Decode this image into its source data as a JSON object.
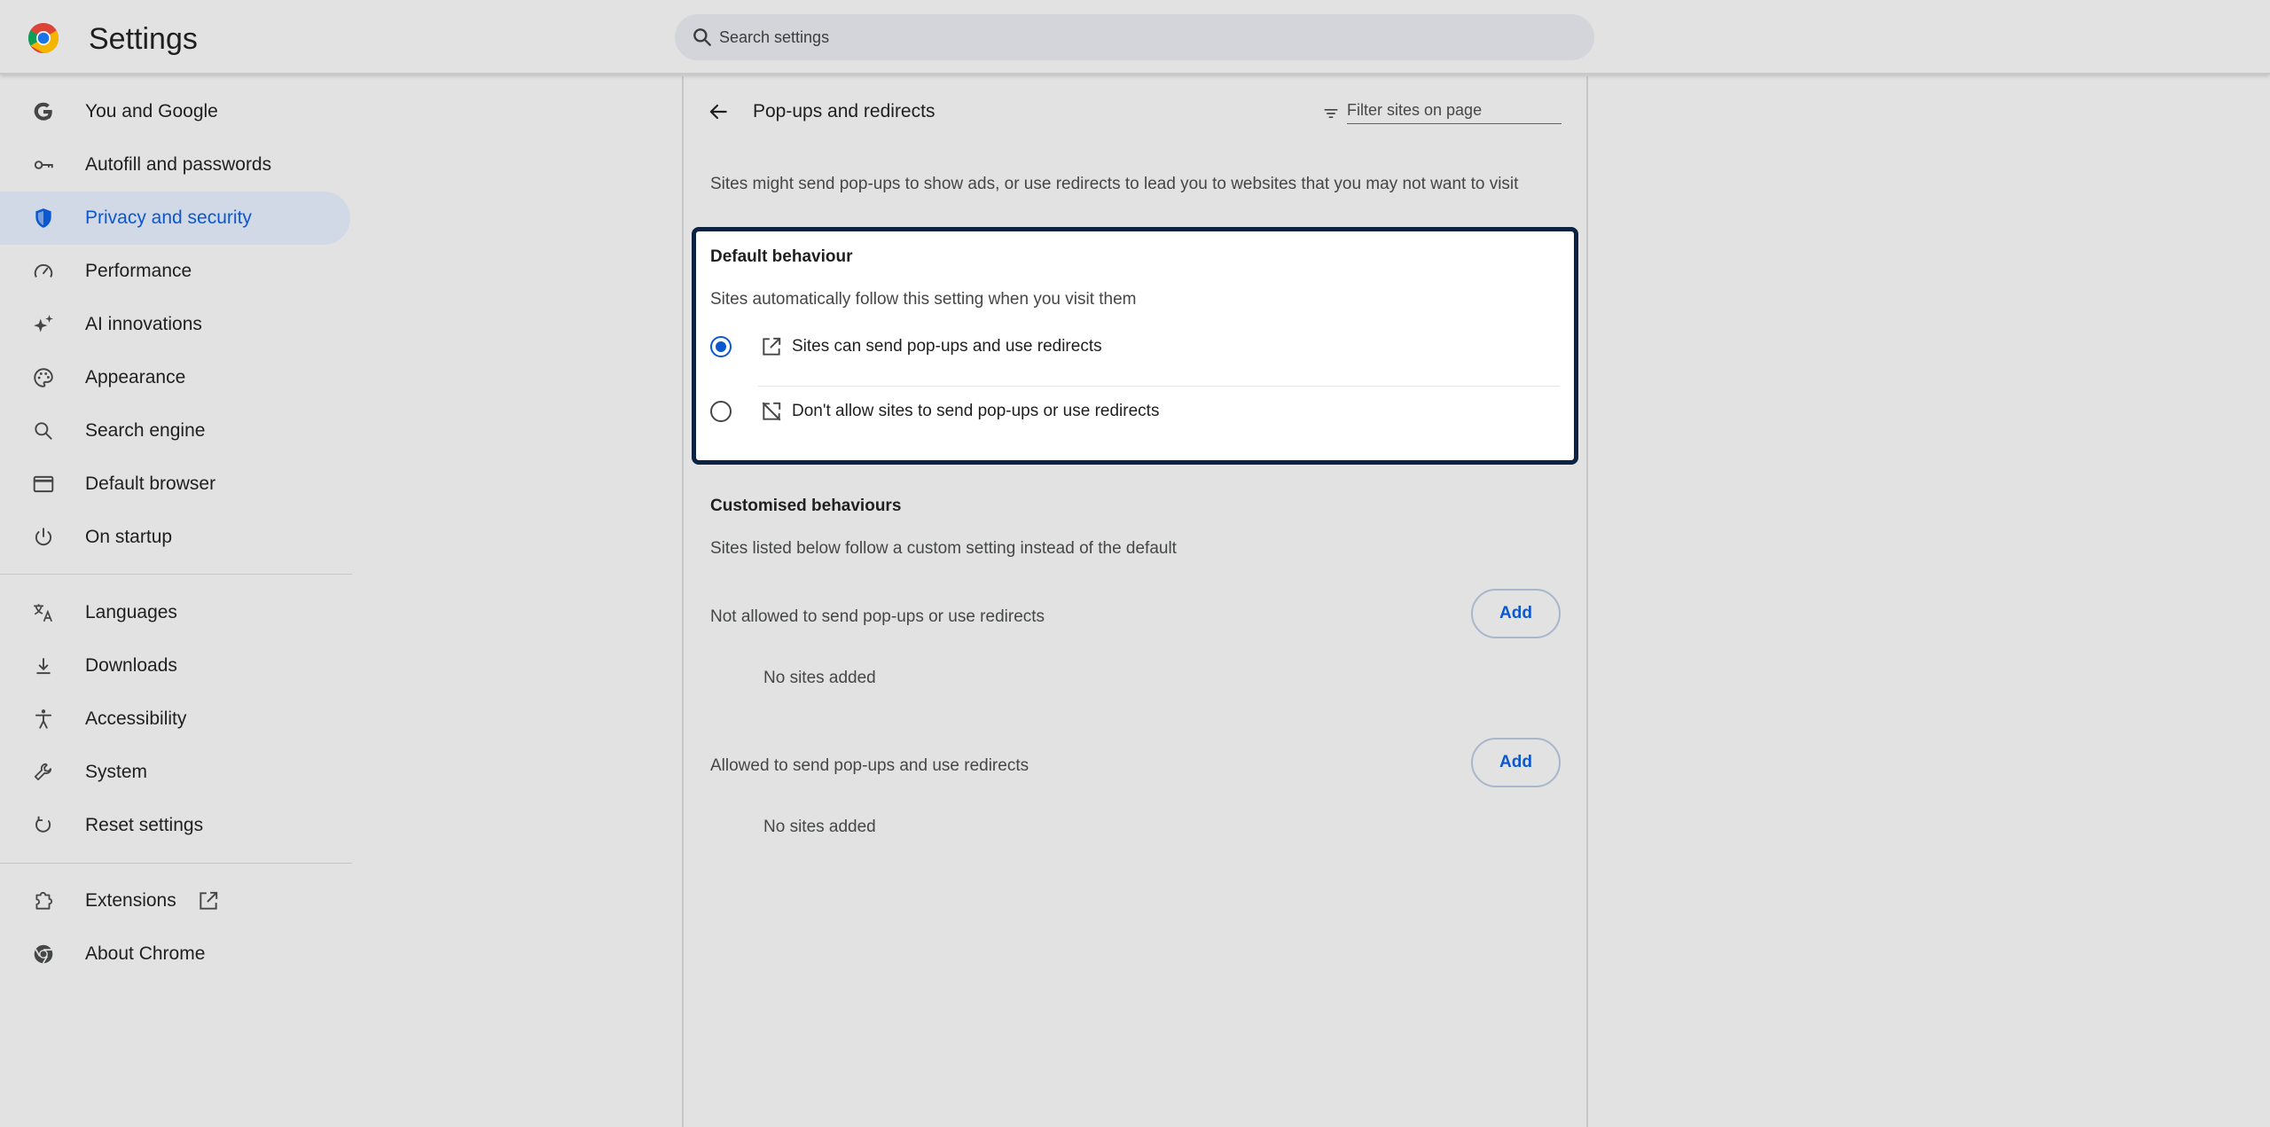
{
  "header": {
    "title": "Settings",
    "search_placeholder": "Search settings"
  },
  "sidebar": {
    "items": [
      {
        "label": "You and Google",
        "icon": "google-g-icon"
      },
      {
        "label": "Autofill and passwords",
        "icon": "key-icon"
      },
      {
        "label": "Privacy and security",
        "icon": "shield-icon",
        "active": true
      },
      {
        "label": "Performance",
        "icon": "speedometer-icon"
      },
      {
        "label": "AI innovations",
        "icon": "sparkle-icon"
      },
      {
        "label": "Appearance",
        "icon": "palette-icon"
      },
      {
        "label": "Search engine",
        "icon": "search-icon"
      },
      {
        "label": "Default browser",
        "icon": "browser-window-icon"
      },
      {
        "label": "On startup",
        "icon": "power-icon"
      },
      {
        "label": "Languages",
        "icon": "translate-icon"
      },
      {
        "label": "Downloads",
        "icon": "download-icon"
      },
      {
        "label": "Accessibility",
        "icon": "accessibility-icon"
      },
      {
        "label": "System",
        "icon": "wrench-icon"
      },
      {
        "label": "Reset settings",
        "icon": "reset-icon"
      },
      {
        "label": "Extensions",
        "icon": "puzzle-icon"
      },
      {
        "label": "About Chrome",
        "icon": "chrome-icon"
      }
    ]
  },
  "main": {
    "title": "Pop-ups and redirects",
    "filter_placeholder": "Filter sites on page",
    "description": "Sites might send pop-ups to show ads, or use redirects to lead you to websites that you may not want to visit",
    "default_behaviour": {
      "heading": "Default behaviour",
      "subtitle": "Sites automatically follow this setting when you visit them",
      "options": [
        {
          "label": "Sites can send pop-ups and use redirects",
          "checked": true
        },
        {
          "label": "Don't allow sites to send pop-ups or use redirects",
          "checked": false
        }
      ]
    },
    "customised": {
      "heading": "Customised behaviours",
      "subtitle": "Sites listed below follow a custom setting instead of the default",
      "lists": [
        {
          "label": "Not allowed to send pop-ups or use redirects",
          "add_label": "Add",
          "empty_text": "No sites added"
        },
        {
          "label": "Allowed to send pop-ups and use redirects",
          "add_label": "Add",
          "empty_text": "No sites added"
        }
      ]
    }
  },
  "colors": {
    "accent": "#0b57d0",
    "active_bg": "#d1d9e6",
    "focus_border": "#0b2242"
  }
}
